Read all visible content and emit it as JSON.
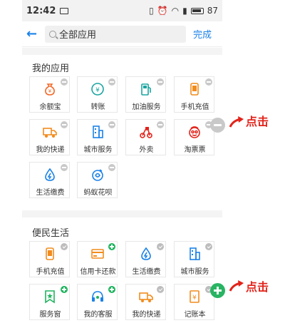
{
  "status_bar": {
    "time": "12:42",
    "battery": "87"
  },
  "search": {
    "back_icon": "back-arrow-icon",
    "query": "全部应用",
    "done_label": "完成"
  },
  "my_apps": {
    "title": "我的应用",
    "items": [
      {
        "label": "余额宝",
        "icon": "money-bag-icon",
        "color": "#f26b2b",
        "badge": "remove"
      },
      {
        "label": "转账",
        "icon": "transfer-icon",
        "color": "#1aa5a0",
        "badge": "remove"
      },
      {
        "label": "加油服务",
        "icon": "fuel-pump-icon",
        "color": "#1aa5a0",
        "badge": "remove"
      },
      {
        "label": "手机充值",
        "icon": "phone-icon",
        "color": "#f28c1d",
        "badge": "remove"
      },
      {
        "label": "我的快递",
        "icon": "truck-icon",
        "color": "#f28c1d",
        "badge": "remove"
      },
      {
        "label": "城市服务",
        "icon": "building-icon",
        "color": "#1b82e8",
        "badge": "remove"
      },
      {
        "label": "外卖",
        "icon": "scooter-icon",
        "color": "#e2231a",
        "badge": "remove"
      },
      {
        "label": "淘票票",
        "icon": "face-icon",
        "color": "#e2231a",
        "badge": "remove"
      },
      {
        "label": "生活缴费",
        "icon": "drop-icon",
        "color": "#1b82e8",
        "badge": "remove"
      },
      {
        "label": "蚂蚁花呗",
        "icon": "flower-icon",
        "color": "#1b82e8",
        "badge": "remove"
      }
    ]
  },
  "convenience": {
    "title": "便民生活",
    "items": [
      {
        "label": "手机充值",
        "icon": "phone-icon",
        "color": "#f28c1d",
        "badge": "check"
      },
      {
        "label": "信用卡还款",
        "icon": "card-icon",
        "color": "#f28c1d",
        "badge": "add"
      },
      {
        "label": "生活缴费",
        "icon": "drop-icon",
        "color": "#1b82e8",
        "badge": "check"
      },
      {
        "label": "城市服务",
        "icon": "building-icon",
        "color": "#1b82e8",
        "badge": "check"
      },
      {
        "label": "服务窗",
        "icon": "star-bookmark-icon",
        "color": "#1fb45f",
        "badge": "add"
      },
      {
        "label": "我的客服",
        "icon": "headset-icon",
        "color": "#1b82e8",
        "badge": "add"
      },
      {
        "label": "我的快递",
        "icon": "truck-icon",
        "color": "#f28c1d",
        "badge": "check"
      },
      {
        "label": "记账本",
        "icon": "ledger-icon",
        "color": "#f28c1d",
        "badge": "check"
      }
    ]
  },
  "callouts": {
    "remove_text": "点击",
    "add_text": "点击",
    "arrow_color": "#e2231a"
  }
}
